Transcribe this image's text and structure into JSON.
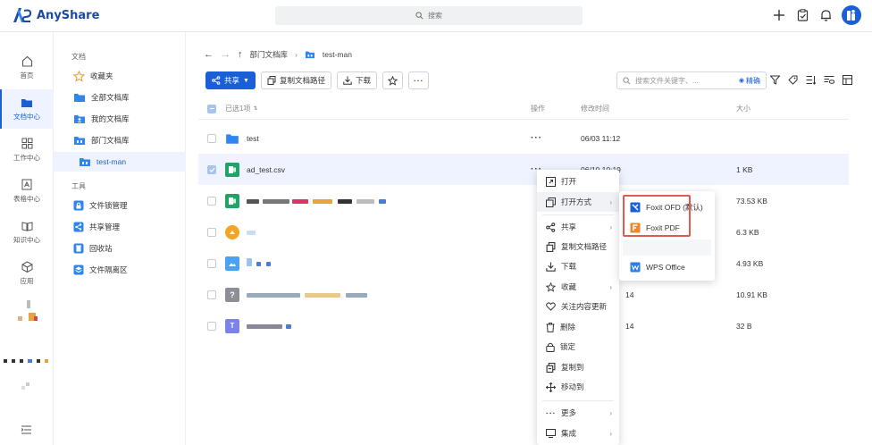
{
  "app": {
    "name": "AnyShare",
    "search_placeholder": "搜索"
  },
  "rail": [
    {
      "label": "首页",
      "icon": "home-icon"
    },
    {
      "label": "文档中心",
      "icon": "folder-icon",
      "active": true
    },
    {
      "label": "工作中心",
      "icon": "grid-icon"
    },
    {
      "label": "表格中心",
      "icon": "table-icon"
    },
    {
      "label": "知识中心",
      "icon": "book-icon"
    },
    {
      "label": "应用",
      "icon": "cube-icon"
    }
  ],
  "nav": {
    "docs_section": "文档",
    "items": [
      {
        "label": "收藏夹",
        "icon": "star-icon"
      },
      {
        "label": "全部文档库",
        "icon": "folder-icon"
      },
      {
        "label": "我的文档库",
        "icon": "user-folder-icon"
      },
      {
        "label": "部门文档库",
        "icon": "dept-folder-icon"
      },
      {
        "label": "test-man",
        "icon": "dept-folder-icon",
        "active": true
      }
    ],
    "tools_section": "工具",
    "tools": [
      {
        "label": "文件锁管理",
        "icon": "lock-icon"
      },
      {
        "label": "共享管理",
        "icon": "share-icon"
      },
      {
        "label": "回收站",
        "icon": "recycle-icon"
      },
      {
        "label": "文件隔离区",
        "icon": "isolation-icon"
      }
    ]
  },
  "breadcrumb": {
    "parent": "部门文档库",
    "current": "test-man"
  },
  "toolbar": {
    "share": "共享",
    "copy_path": "复制文档路径",
    "download": "下载"
  },
  "file_search": {
    "placeholder": "搜索文件关键字、...",
    "precise": "精确"
  },
  "table": {
    "selected": "已选1项",
    "col_ops": "操作",
    "col_mtime": "修改时间",
    "col_size": "大小",
    "rows": [
      {
        "name": "test",
        "mtime": "06/03 11:12",
        "size": ""
      },
      {
        "name": "ad_test.csv",
        "mtime": "06/10 10:19",
        "size": "1 KB",
        "selected": true
      },
      {
        "name": "",
        "mtime": "",
        "size": "73.53 KB"
      },
      {
        "name": "",
        "mtime": "",
        "size": "6.3 KB"
      },
      {
        "name": "",
        "mtime": "",
        "size": "4.93 KB"
      },
      {
        "name": "",
        "mtime": "14",
        "size": "10.91 KB"
      },
      {
        "name": "",
        "mtime": "14",
        "size": "32 B"
      }
    ]
  },
  "context_menu": [
    {
      "label": "打开",
      "icon": "open-icon"
    },
    {
      "label": "打开方式",
      "icon": "open-with-icon",
      "sub": true,
      "hover": true
    },
    {
      "label": "共享",
      "icon": "share-icon",
      "sub": true
    },
    {
      "label": "复制文档路径",
      "icon": "copy-icon"
    },
    {
      "label": "下载",
      "icon": "download-icon"
    },
    {
      "label": "收藏",
      "icon": "star-icon",
      "sub": true
    },
    {
      "label": "关注内容更新",
      "icon": "heart-icon"
    },
    {
      "label": "删除",
      "icon": "trash-icon"
    },
    {
      "label": "锁定",
      "icon": "lock-icon"
    },
    {
      "label": "复制到",
      "icon": "copy-to-icon"
    },
    {
      "label": "移动到",
      "icon": "move-icon"
    },
    {
      "label": "更多",
      "icon": "more-icon",
      "sub": true
    },
    {
      "label": "集成",
      "icon": "integrate-icon",
      "sub": true
    }
  ],
  "open_with": [
    {
      "label": "Foxit OFD (默认)",
      "icon": "foxit-ofd-icon",
      "color": "#1a5fd6"
    },
    {
      "label": "Foxit PDF",
      "icon": "foxit-pdf-icon",
      "color": "#e8892b"
    },
    {
      "label": "WPS Office",
      "icon": "wps-office-icon",
      "color": "#2b7de9"
    }
  ],
  "colors": {
    "brand": "#1a5fd6",
    "highlight": "#e05a4f"
  }
}
